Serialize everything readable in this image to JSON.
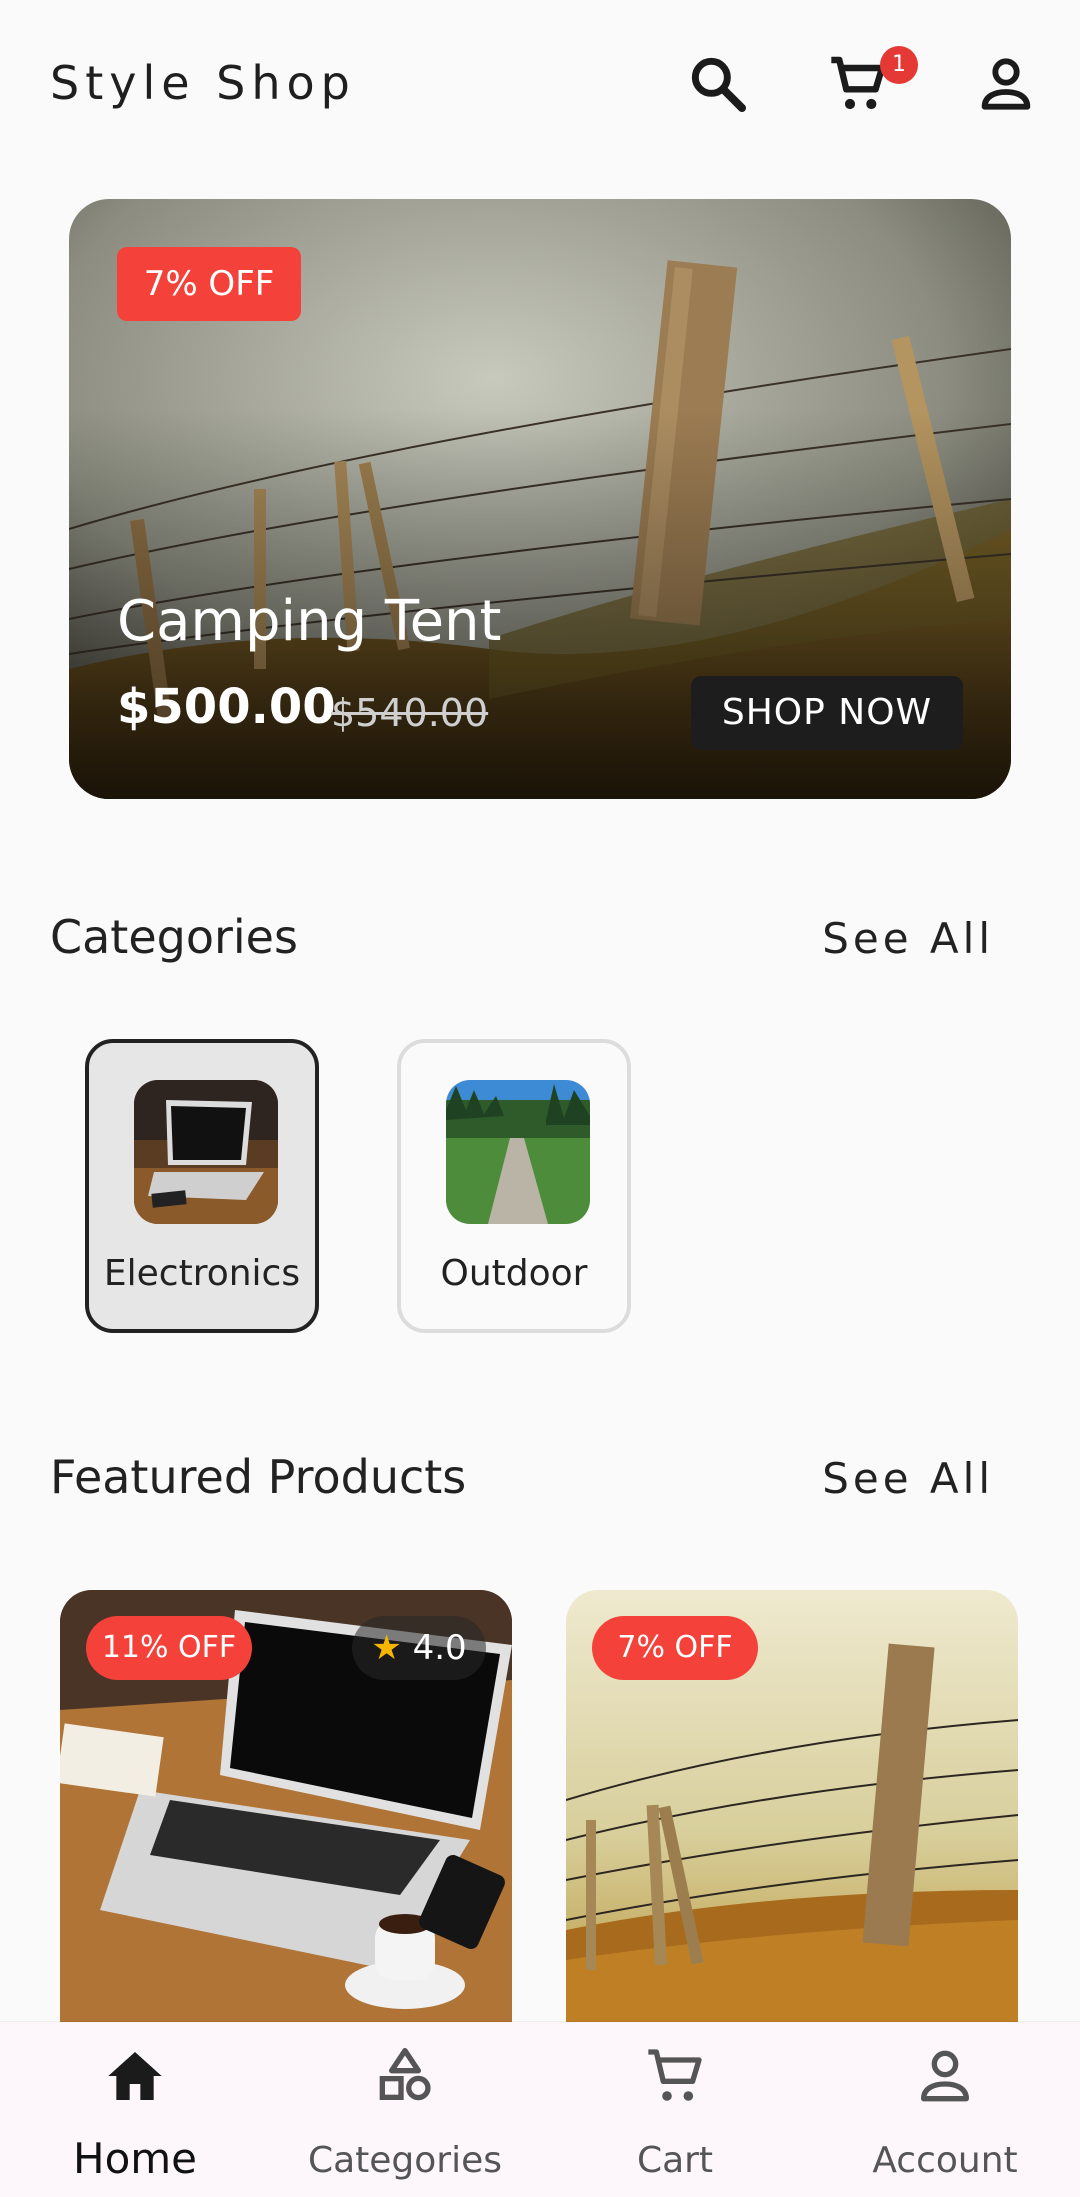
{
  "app": {
    "title": "Style Shop"
  },
  "header": {
    "cart_count": "1"
  },
  "hero": {
    "discount": "7% OFF",
    "title": "Camping Tent",
    "price": "$500.00",
    "old_price": "$540.00",
    "cta": "SHOP NOW"
  },
  "categories": {
    "title": "Categories",
    "see_all": "See All",
    "items": [
      {
        "label": "Electronics",
        "selected": true
      },
      {
        "label": "Outdoor",
        "selected": false
      }
    ]
  },
  "featured": {
    "title": "Featured Products",
    "see_all": "See All",
    "products": [
      {
        "discount": "11% OFF",
        "rating": "4.0"
      },
      {
        "discount": "7% OFF"
      }
    ]
  },
  "nav": {
    "items": [
      {
        "label": "Home",
        "icon": "home-icon",
        "active": true
      },
      {
        "label": "Categories",
        "icon": "categories-icon",
        "active": false
      },
      {
        "label": "Cart",
        "icon": "cart-icon",
        "active": false
      },
      {
        "label": "Account",
        "icon": "account-icon",
        "active": false
      }
    ]
  },
  "colors": {
    "accent_red": "#f4423a",
    "dark": "#1d1d1d",
    "background": "#fafafa",
    "star": "#f7b500"
  }
}
